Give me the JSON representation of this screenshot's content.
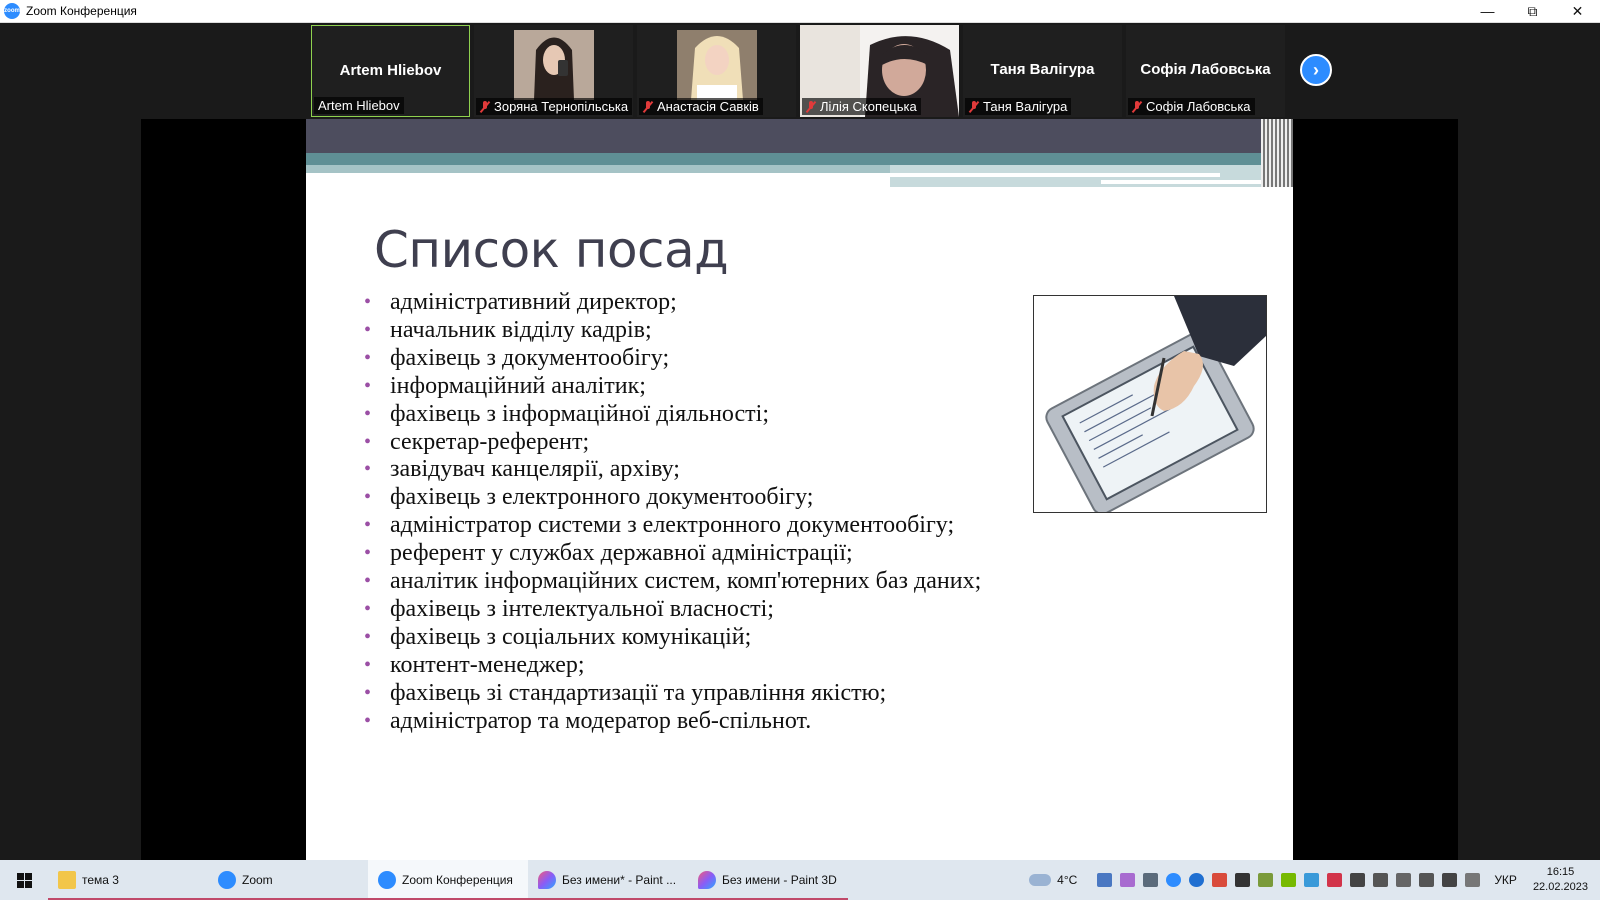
{
  "window": {
    "title": "Zoom Конференция",
    "app_icon_text": "zoom"
  },
  "gallery": {
    "tiles": [
      {
        "display_name": "Artem Hliebov",
        "label": "Artem Hliebov",
        "muted": false,
        "has_video": false,
        "active": true
      },
      {
        "display_name": "",
        "label": "Зоряна Тернопільська",
        "muted": true,
        "has_video": true,
        "active": false
      },
      {
        "display_name": "",
        "label": "Анастасія Савків",
        "muted": true,
        "has_video": true,
        "active": false
      },
      {
        "display_name": "",
        "label": "Лілія Скопецька",
        "muted": true,
        "has_video": true,
        "active": false
      },
      {
        "display_name": "Таня Валігура",
        "label": "Таня Валігура",
        "muted": true,
        "has_video": false,
        "active": false
      },
      {
        "display_name": "Софія Лабовська",
        "label": "Софія Лабовська",
        "muted": true,
        "has_video": false,
        "active": false
      }
    ],
    "next_icon": "chevron-right-icon"
  },
  "slide": {
    "title": "Список посад",
    "bullet_glyph": "•",
    "items": [
      "адміністративний директор;",
      "начальник відділу кадрів;",
      "фахівець з документообігу;",
      "інформаційний аналітик;",
      "фахівець з інформаційної діяльності;",
      "секретар-референт;",
      "завідувач канцелярії, архіву;",
      "фахівець з електронного документообігу;",
      "адміністратор системи з електронного документообігу;",
      "референт у службах державної адміністрації;",
      "аналітик інформаційних систем, комп'ютерних баз даних;",
      "фахівець з інтелектуальної власності;",
      "фахівець з соціальних комунікацій;",
      "контент-менеджер;",
      "фахівець зі стандартизації та управління якістю;",
      "адміністратор та модератор веб-спільнот."
    ],
    "image": "tablet-with-stylus-illustration"
  },
  "taskbar": {
    "tasks": [
      {
        "label": "тема 3",
        "icon": "folder-icon",
        "active": false
      },
      {
        "label": "Zoom",
        "icon": "zoom-icon",
        "active": false
      },
      {
        "label": "Zoom Конференция",
        "icon": "zoom-icon",
        "active": true
      },
      {
        "label": "Без имени* - Paint ...",
        "icon": "paint3d-icon",
        "active": false
      },
      {
        "label": "Без имени - Paint 3D",
        "icon": "paint3d-icon",
        "active": false
      }
    ],
    "weather": "4°C",
    "language": "УКР",
    "time": "16:15",
    "date": "22.02.2023"
  },
  "colors": {
    "zoom_blue": "#2d8cff",
    "active_speaker_border": "#8fd14f",
    "bullet": "#9b4fa5",
    "slide_title": "#3f3f4f",
    "muted_mic": "#e03a3a"
  }
}
